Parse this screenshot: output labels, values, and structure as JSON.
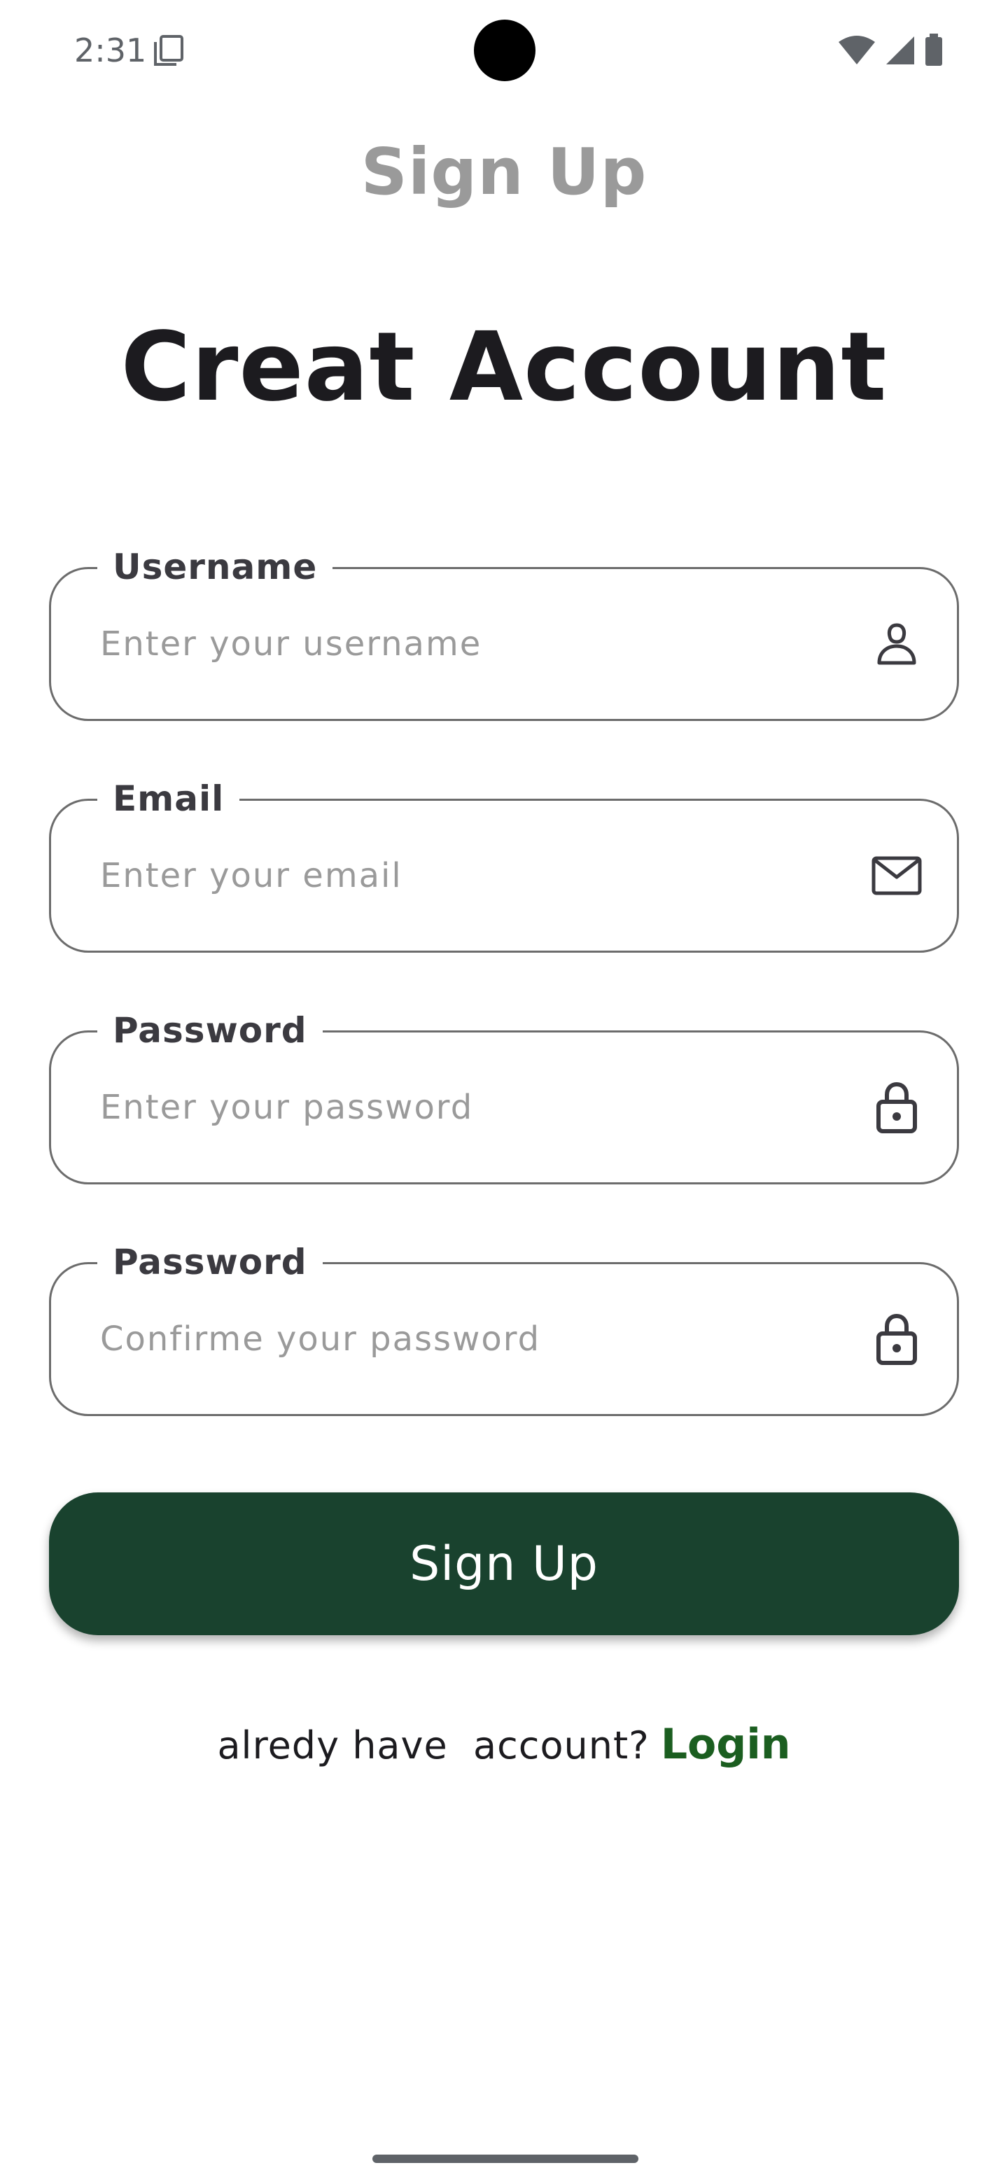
{
  "status_bar": {
    "time": "2:31",
    "icons": [
      "notification-card-icon",
      "wifi-icon",
      "cell-signal-icon",
      "battery-icon"
    ]
  },
  "header": {
    "top_title": "Sign Up",
    "heading": "Creat Account"
  },
  "form": {
    "fields": [
      {
        "label": "Username",
        "placeholder": "Enter your username",
        "value": "",
        "icon": "person-icon"
      },
      {
        "label": "Email",
        "placeholder": "Enter your email",
        "value": "",
        "icon": "mail-icon"
      },
      {
        "label": "Password",
        "placeholder": "Enter your password",
        "value": "",
        "icon": "lock-icon"
      },
      {
        "label": "Password",
        "placeholder": "Confirme your password",
        "value": "",
        "icon": "lock-icon"
      }
    ],
    "submit_label": "Sign Up"
  },
  "footer": {
    "prompt": "alredy have  account?",
    "login_label": "Login"
  },
  "colors": {
    "primary_button": "#19422e",
    "login_link": "#1b5e20",
    "muted_title": "#9a9a9a",
    "field_border": "#6c6c6c"
  }
}
